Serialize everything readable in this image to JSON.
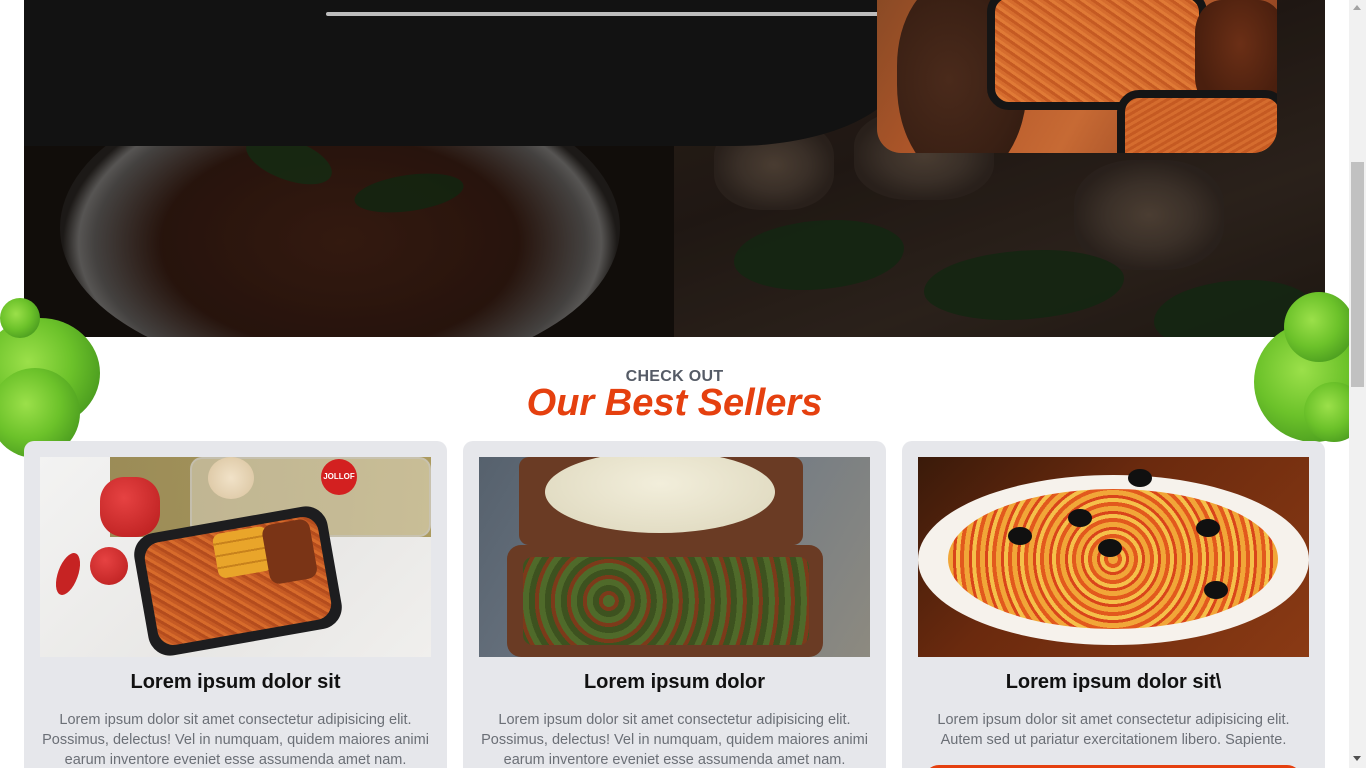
{
  "section": {
    "kicker": "CHECK OUT",
    "title": "Our Best Sellers"
  },
  "cards": [
    {
      "title": "Lorem ipsum dolor sit",
      "description": "Lorem ipsum dolor sit amet consectetur adipisicing elit. Possimus, delectus! Vel in numquam, quidem maiores animi earum inventore eveniet esse assumenda amet nam.",
      "image_icon": "jollof-rice-tray-image",
      "badge": "JOLLOF"
    },
    {
      "title": "Lorem ipsum dolor",
      "description": "Lorem ipsum dolor sit amet consectetur adipisicing elit. Possimus, delectus! Vel in numquam, quidem maiores animi earum inventore eveniet esse assumenda amet nam.",
      "image_icon": "pounded-yam-soup-image"
    },
    {
      "title": "Lorem ipsum dolor sit\\",
      "description": "Lorem ipsum dolor sit amet consectetur adipisicing elit. Autem sed ut pariatur exercitationem libero. Sapiente.",
      "image_icon": "pasta-plate-image"
    }
  ],
  "colors": {
    "accent": "#e5400f",
    "card_bg": "#e6e7eb",
    "kicker": "#555b66"
  }
}
